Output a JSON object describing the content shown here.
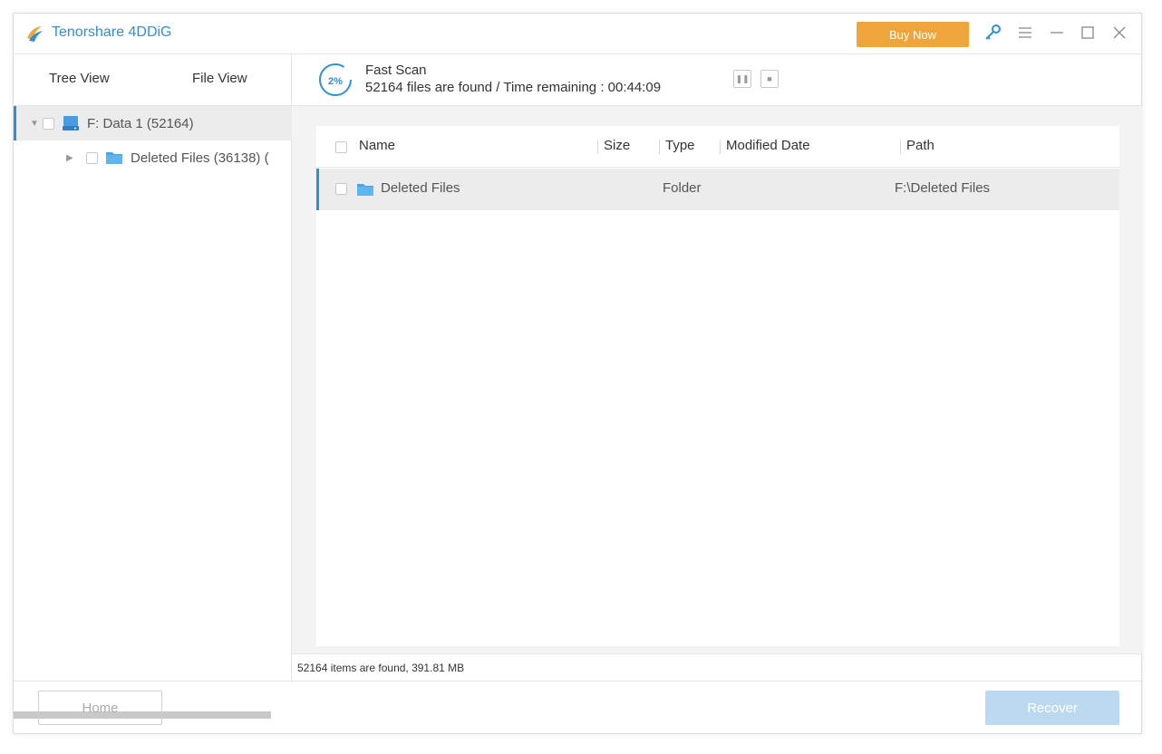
{
  "app": {
    "title": "Tenorshare 4DDiG",
    "buy_now": "Buy Now",
    "icons": [
      "logo-icon",
      "key-icon",
      "menu-icon",
      "minimize-icon",
      "maximize-icon",
      "close-icon"
    ],
    "accent": "#2f8fd6",
    "buy_color": "#f0a53c"
  },
  "left": {
    "tabs": [
      {
        "label": "Tree View"
      },
      {
        "label": "File View"
      }
    ],
    "tree": [
      {
        "label": "F: Data 1 (52164)",
        "icon": "drive-icon",
        "selected": true
      },
      {
        "label": "Deleted Files (36138) (",
        "icon": "folder-icon",
        "selected": false
      }
    ]
  },
  "scan": {
    "progress": "2%",
    "title": "Fast Scan",
    "status": "52164 files are found /  Time remaining : 00:44:09"
  },
  "table": {
    "headers": [
      "Name",
      "Size",
      "Type",
      "Modified Date",
      "Path"
    ],
    "rows": [
      {
        "name": "Deleted Files",
        "size": "",
        "type": "Folder",
        "modified": "",
        "path": "F:\\Deleted Files"
      }
    ]
  },
  "summary": "52164 items are found, 391.81 MB",
  "footer": {
    "home": "Home",
    "recover": "Recover"
  }
}
